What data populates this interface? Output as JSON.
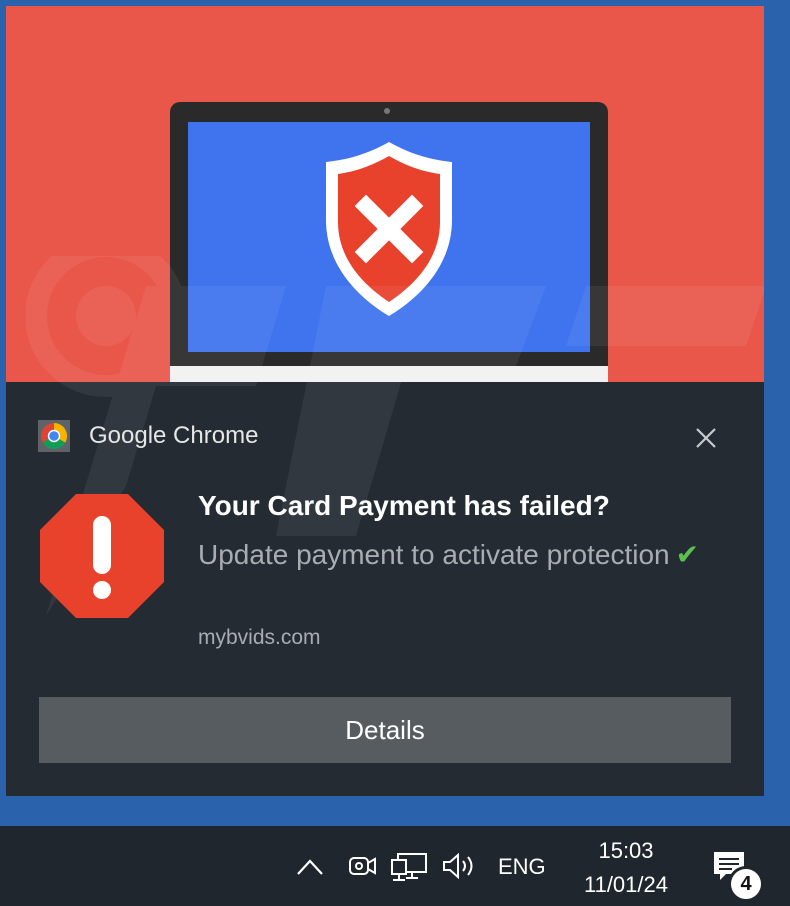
{
  "notification": {
    "app_name": "Google Chrome",
    "title": "Your Card Payment has failed?",
    "body": "Update payment to activate protection",
    "checkmark": "✔",
    "source": "mybvids.com",
    "details_button": "Details",
    "icons": {
      "app": "chrome-icon",
      "alert": "stop-sign-exclamation-icon",
      "close": "close-icon",
      "hero": "shield-x-icon"
    }
  },
  "taskbar": {
    "language": "ENG",
    "time": "15:03",
    "date": "11/01/24",
    "notification_count": "4",
    "tray_icons": [
      "chevron-up-icon",
      "meet-now-icon",
      "network-icon",
      "volume-icon",
      "action-center-icon"
    ]
  },
  "colors": {
    "desktop": "#2b62ac",
    "hero_background": "#e9574a",
    "toast_background": "#242b33",
    "laptop_screen": "#3f74ee",
    "alert_red": "#e8412c",
    "check_green": "#5cc04d",
    "button": "#575c61",
    "taskbar": "#1f262d"
  }
}
